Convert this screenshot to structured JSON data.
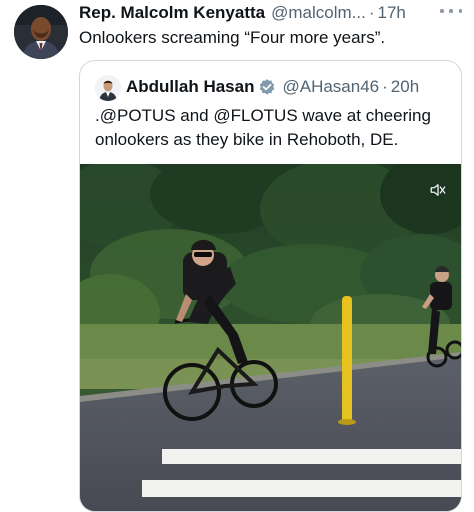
{
  "tweet": {
    "author_name": "Rep. Malcolm Kenyatta",
    "author_handle": "@malcolm...",
    "separator": "·",
    "time": "17h",
    "text": "Onlookers screaming “Four more years”."
  },
  "quoted_tweet": {
    "author_name": "Abdullah Hasan",
    "author_handle": "@AHasan46",
    "separator": "·",
    "time": "20h",
    "text": ".@POTUS and @FLOTUS wave at cheering onlookers as they bike in Rehoboth, DE."
  },
  "icons": {
    "more": "more-horizontal-icon",
    "verified": "verified-badge-icon",
    "media_audio": "muted-speaker-icon"
  },
  "colors": {
    "text_primary": "#0f1419",
    "text_secondary": "#536471",
    "border": "#cfd9de",
    "verified_badge": "#829aab"
  }
}
